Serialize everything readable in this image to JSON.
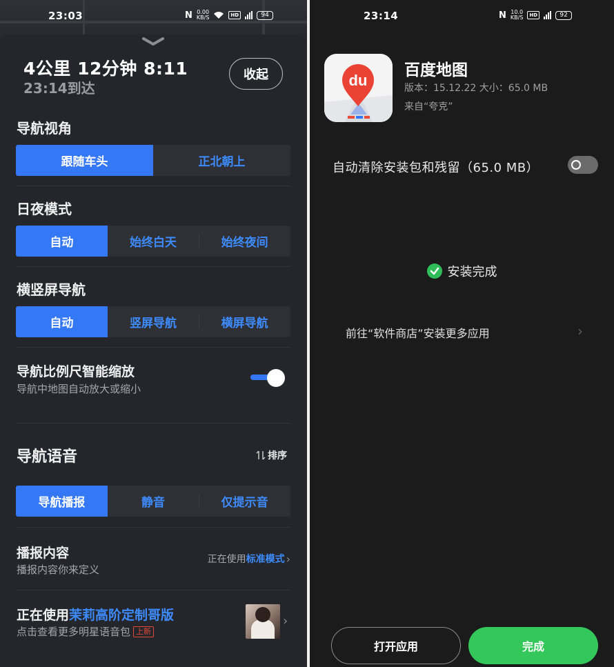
{
  "left": {
    "status_bar": {
      "time": "23:03",
      "speed_value": "0.00",
      "speed_unit": "KB/S",
      "battery": "94"
    },
    "map_text": "",
    "eta": {
      "summary": "4公里 12分钟 8:11",
      "arrival": "23:14到达"
    },
    "collapse_label": "收起",
    "view_angle": {
      "title": "导航视角",
      "options": [
        "跟随车头",
        "正北朝上"
      ],
      "selected": 0
    },
    "day_night": {
      "title": "日夜模式",
      "options": [
        "自动",
        "始终白天",
        "始终夜间"
      ],
      "selected": 0
    },
    "orientation": {
      "title": "横竖屏导航",
      "options": [
        "自动",
        "竖屏导航",
        "横屏导航"
      ],
      "selected": 0
    },
    "scale_zoom": {
      "title": "导航比例尺智能缩放",
      "subtitle": "导航中地图自动放大或缩小",
      "enabled": true
    },
    "voice": {
      "title": "导航语音",
      "sort_label": "排序",
      "options": [
        "导航播报",
        "静音",
        "仅提示音"
      ],
      "selected": 0
    },
    "broadcast": {
      "title": "播报内容",
      "subtitle": "播报内容你来定义",
      "using_prefix": "正在使用",
      "mode": "标准模式"
    },
    "voice_pack": {
      "prefix": "正在使用",
      "name": "茉莉高阶定制哥版",
      "subtitle": "点击查看更多明星语音包",
      "badge": "上新"
    }
  },
  "right": {
    "status_bar": {
      "time": "23:14",
      "speed_value": "10.0",
      "speed_unit": "KB/S",
      "battery": "92"
    },
    "app": {
      "name": "百度地图",
      "meta": "版本：15.12.22   大小：65.0 MB",
      "source": "来自“夸克”",
      "icon_text": "du"
    },
    "auto_clean": {
      "label": "自动清除安装包和残留（65.0 MB）",
      "enabled": false
    },
    "install_status": "安装完成",
    "store_link": "前往“软件商店”安装更多应用",
    "buttons": {
      "open": "打开应用",
      "done": "完成"
    }
  },
  "colors": {
    "accent_blue": "#3478f6",
    "link_blue": "#3d8bfd",
    "success_green": "#34c759",
    "left_bg": "#24262b",
    "right_bg": "#1b1b1b"
  }
}
